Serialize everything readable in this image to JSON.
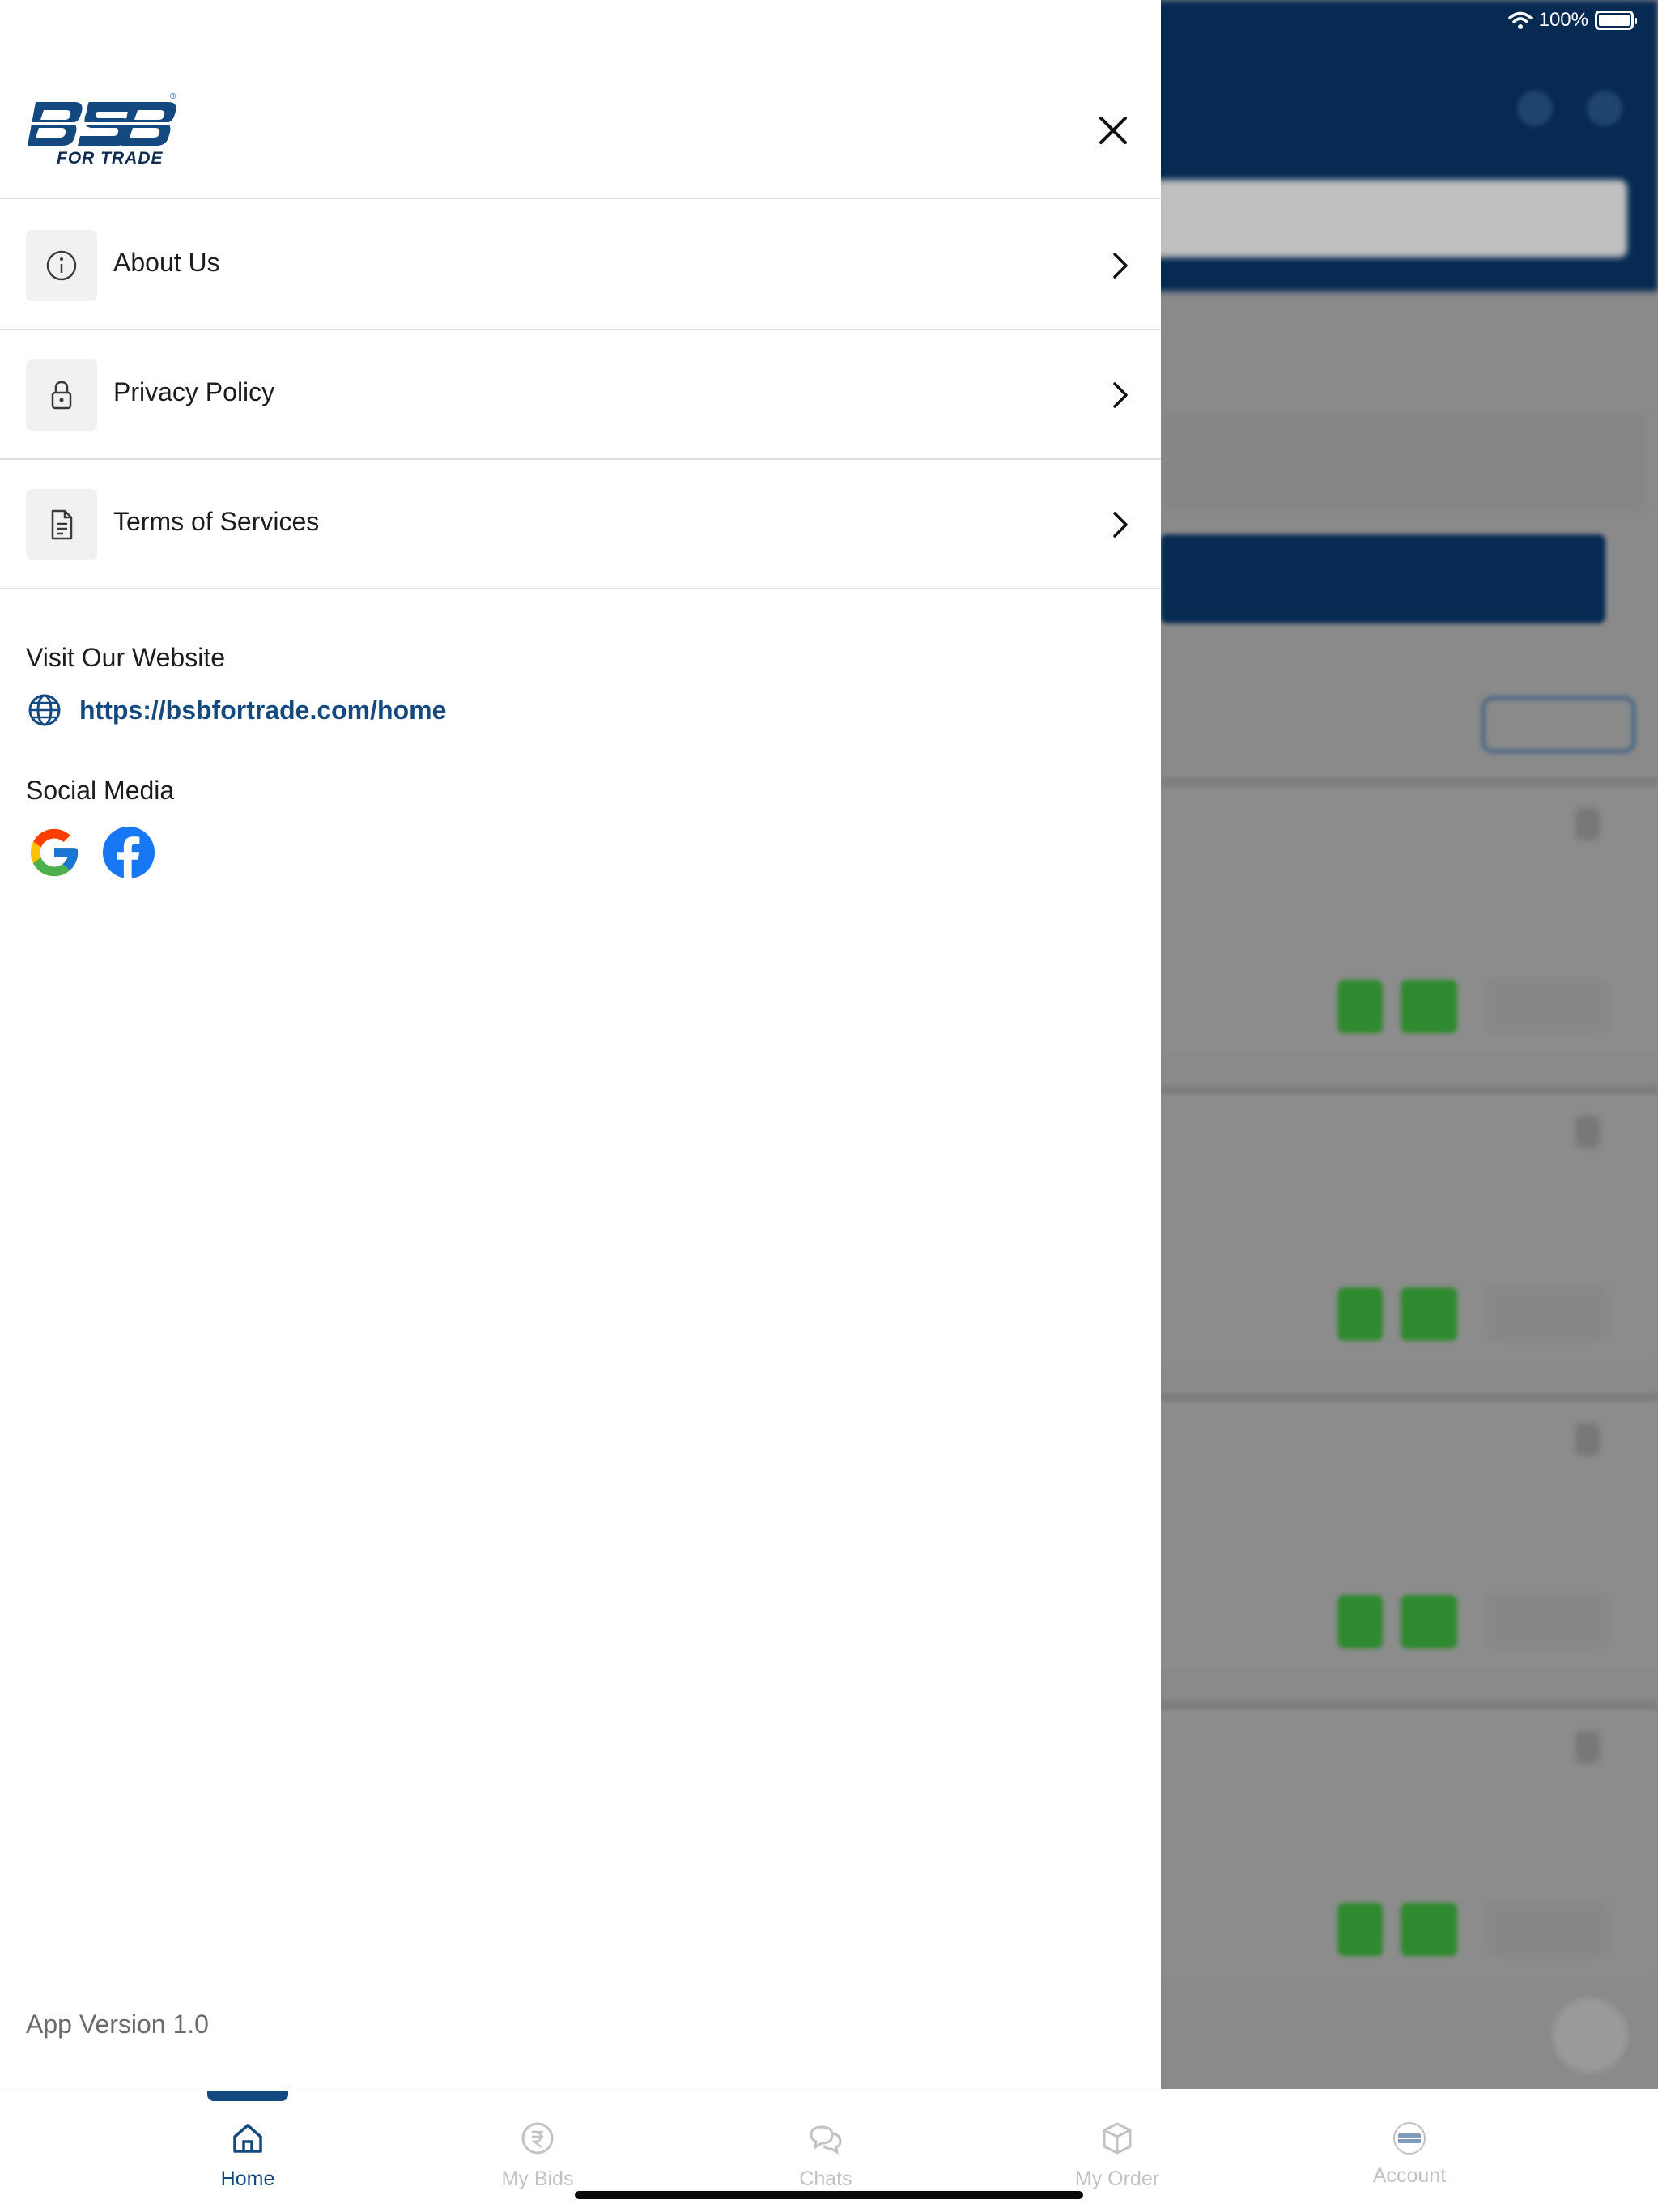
{
  "status_bar": {
    "battery_text": "100%"
  },
  "drawer": {
    "logo": {
      "brand": "BSB",
      "tagline": "FOR TRADE",
      "registered": "®"
    },
    "menu_items": [
      {
        "label": "About Us",
        "icon": "info-icon"
      },
      {
        "label": "Privacy Policy",
        "icon": "lock-icon"
      },
      {
        "label": "Terms of Services",
        "icon": "document-icon"
      }
    ],
    "website": {
      "title": "Visit Our Website",
      "url": "https://bsbfortrade.com/home",
      "icon": "globe-icon"
    },
    "social": {
      "title": "Social Media",
      "items": [
        {
          "name": "Google",
          "icon": "google-icon"
        },
        {
          "name": "Facebook",
          "icon": "facebook-icon"
        }
      ]
    },
    "app_version": "App Version 1.0"
  },
  "tabbar": {
    "active": "Home",
    "tabs": [
      {
        "label": "Home",
        "icon": "home-icon"
      },
      {
        "label": "My Bids",
        "icon": "rupee-icon"
      },
      {
        "label": "Chats",
        "icon": "chat-icon"
      },
      {
        "label": "My Order",
        "icon": "box-icon"
      },
      {
        "label": "Account",
        "icon": "account-logo-icon"
      }
    ]
  },
  "colors": {
    "brand_navy": "#14497f",
    "header_navy": "#062a52",
    "green": "#2f8a2f"
  }
}
